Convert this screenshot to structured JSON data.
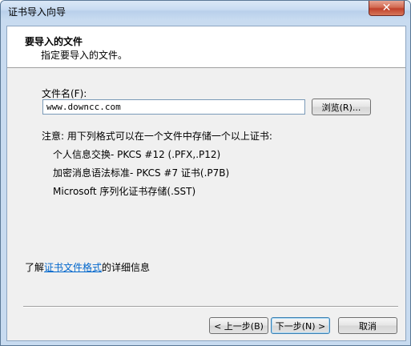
{
  "window": {
    "title": "证书导入向导",
    "close_label": "✕"
  },
  "header": {
    "title": "要导入的文件",
    "subtitle": "指定要导入的文件。"
  },
  "file": {
    "label": "文件名(F):",
    "value": "www.downcc.com",
    "browse_label": "浏览(R)..."
  },
  "formats": {
    "note": "注意: 用下列格式可以在一个文件中存储一个以上证书:",
    "items": [
      "个人信息交换- PKCS #12 (.PFX,.P12)",
      "加密消息语法标准- PKCS #7 证书(.P7B)",
      "Microsoft 序列化证书存储(.SST)"
    ]
  },
  "info": {
    "prefix": "了解",
    "link": "证书文件格式",
    "suffix": "的详细信息"
  },
  "buttons": {
    "back": "< 上一步(B)",
    "next": "下一步(N) >",
    "cancel": "取消"
  }
}
